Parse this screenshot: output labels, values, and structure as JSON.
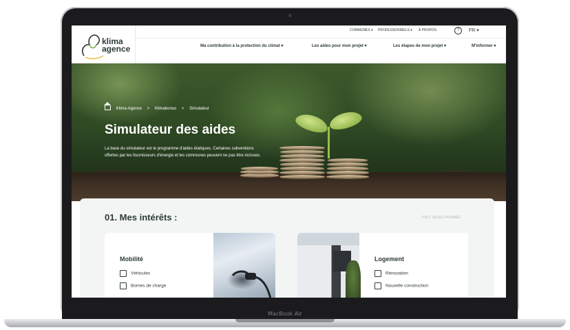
{
  "device": {
    "model_label": "MacBook Air"
  },
  "brand": {
    "name_line1": "klima",
    "name_line2": "agence",
    "accent": "#2d3b36"
  },
  "topbar": {
    "links": [
      "COMMUNES ▾",
      "PROFESSIONNELS ▾",
      "À PROPOS"
    ],
    "help_icon": "question-icon",
    "language": "FR ▾"
  },
  "nav": {
    "items": [
      "Ma contribution à la protection du climat ▾",
      "Les aides pour mon projet ▾",
      "Les étapes de mon projet ▾",
      "M'informer ▾"
    ]
  },
  "hero": {
    "breadcrumb": [
      "Klima-Agence",
      ">",
      "Klimabonus",
      ">",
      "Simulateur"
    ],
    "title": "Simulateur des aides",
    "description": "La base du simulateur est le programme d'aides étatiques. Certaines subventions offertes par les fournisseurs d'énergie et les communes peuvent ne pas être incluses."
  },
  "interests": {
    "section_title": "01.  Mes intérêts :",
    "select_all": "TOUT SÉLECTIONNER",
    "cards": [
      {
        "title": "Mobilité",
        "options": [
          "Véhicules",
          "Bornes de charge"
        ],
        "image": "electric-car-charging-image"
      },
      {
        "title": "Logement",
        "options": [
          "Rénovation",
          "Nouvelle construction"
        ],
        "image": "modern-house-image"
      }
    ]
  }
}
